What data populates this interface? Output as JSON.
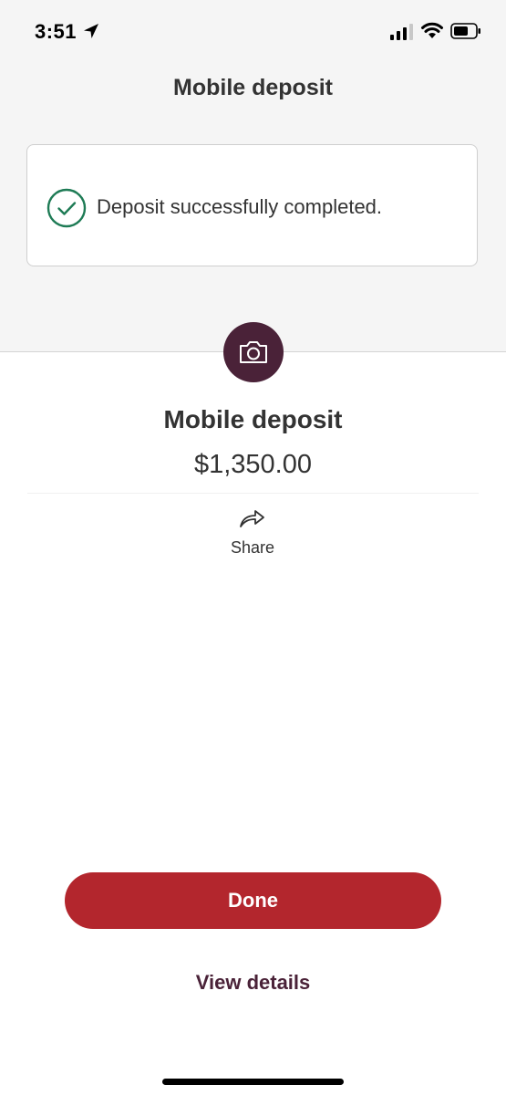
{
  "status_bar": {
    "time": "3:51"
  },
  "header": {
    "title": "Mobile deposit"
  },
  "alert": {
    "message": "Deposit successfully completed.",
    "icon": "check-circle-icon",
    "color": "#1e7b55"
  },
  "deposit": {
    "icon": "camera-icon",
    "title": "Mobile deposit",
    "amount": "$1,350.00"
  },
  "actions": {
    "share_label": "Share",
    "done_label": "Done",
    "view_details_label": "View details"
  },
  "colors": {
    "brand_plum": "#4a2238",
    "primary_red": "#b3262d",
    "success_green": "#1e7b55"
  }
}
